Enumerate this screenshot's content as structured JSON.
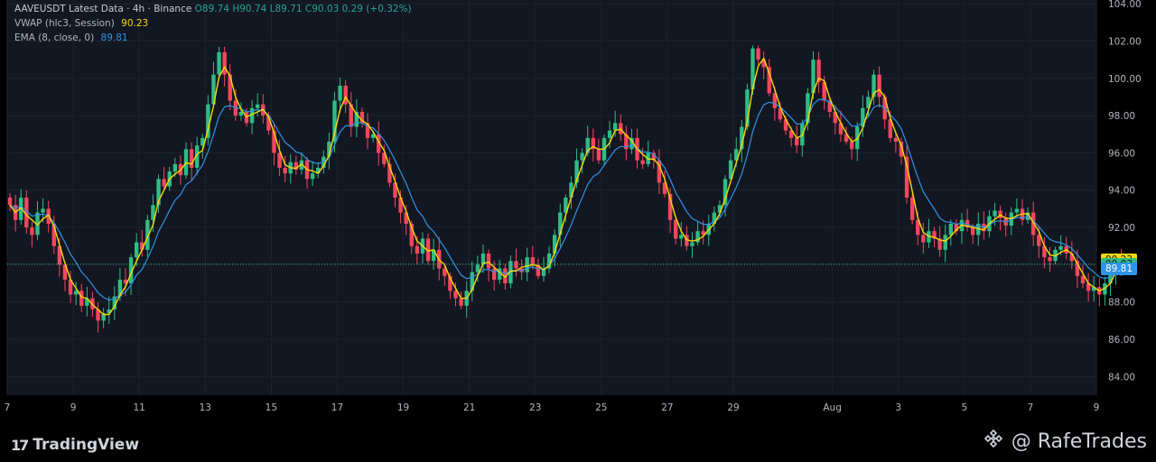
{
  "legend": {
    "symbol": "AAVEUSDT Latest Data · 4h · Binance",
    "ohlc_text": "O89.74 H90.74 L89.71 C90.03 0.29 (+0.32%)",
    "vwap_label": "VWAP (hlc3, Session)",
    "vwap_value": "90.23",
    "ema_label": "EMA (8, close, 0)",
    "ema_value": "89.81"
  },
  "footer": {
    "brand_mark": "17",
    "brand_name": "TradingView",
    "watermark": "@ RafeTrades"
  },
  "badges": {
    "vwap": "90.23",
    "close": "90.03",
    "ema": "89.81"
  },
  "colors": {
    "background": "#000000",
    "up": "#26a69a",
    "down": "#ef5350",
    "up_candle": "#2ebd85",
    "down_candle": "#f6465d",
    "vwap": "#f5d90a",
    "ema": "#2f93e6",
    "grid": "#1e222d",
    "text": "#b2b5be"
  },
  "chart_data": {
    "type": "candlestick",
    "y_ticks": [
      "104.00",
      "102.00",
      "100.00",
      "98.00",
      "96.00",
      "94.00",
      "92.00",
      "90.00",
      "88.00",
      "86.00",
      "84.00"
    ],
    "ylim": [
      83.0,
      104.2
    ],
    "x_ticks": [
      {
        "label": "7",
        "day": 7
      },
      {
        "label": "9",
        "day": 9
      },
      {
        "label": "11",
        "day": 11
      },
      {
        "label": "13",
        "day": 13
      },
      {
        "label": "15",
        "day": 15
      },
      {
        "label": "17",
        "day": 17
      },
      {
        "label": "19",
        "day": 19
      },
      {
        "label": "21",
        "day": 21
      },
      {
        "label": "23",
        "day": 23
      },
      {
        "label": "25",
        "day": 25
      },
      {
        "label": "27",
        "day": 27
      },
      {
        "label": "29",
        "day": 29
      },
      {
        "label": "Aug",
        "day": 32
      },
      {
        "label": "3",
        "day": 34
      },
      {
        "label": "5",
        "day": 36
      },
      {
        "label": "7",
        "day": 38
      },
      {
        "label": "9",
        "day": 40
      }
    ],
    "xlim": [
      7.0,
      40.0
    ],
    "candle_start_day": 7.0,
    "candle_interval_days": 0.1667,
    "close_series": [
      93.2,
      92.4,
      93.6,
      92.0,
      91.6,
      92.8,
      93.0,
      92.2,
      91.0,
      90.0,
      89.2,
      88.4,
      88.6,
      87.8,
      88.2,
      87.6,
      87.0,
      87.4,
      87.6,
      88.3,
      89.2,
      89.0,
      90.4,
      91.2,
      90.8,
      92.4,
      93.2,
      94.6,
      94.2,
      95.0,
      95.4,
      94.8,
      96.2,
      95.2,
      96.4,
      96.8,
      98.6,
      100.2,
      101.4,
      100.2,
      98.8,
      98.0,
      98.2,
      97.6,
      98.4,
      98.6,
      98.0,
      97.2,
      96.0,
      95.2,
      94.9,
      95.5,
      95.1,
      95.6,
      94.6,
      94.9,
      95.2,
      95.8,
      96.6,
      98.8,
      99.6,
      98.6,
      97.4,
      98.2,
      97.6,
      96.8,
      97.0,
      96.0,
      95.4,
      94.4,
      93.6,
      92.8,
      92.2,
      91.0,
      90.6,
      91.4,
      90.2,
      90.8,
      89.8,
      89.4,
      88.6,
      88.2,
      87.8,
      88.6,
      89.6,
      90.0,
      90.6,
      89.8,
      89.2,
      89.8,
      89.0,
      90.2,
      89.8,
      89.6,
      90.4,
      90.0,
      89.4,
      89.8,
      90.6,
      91.6,
      92.8,
      93.6,
      94.4,
      95.6,
      96.0,
      96.8,
      96.2,
      95.6,
      96.8,
      97.2,
      97.6,
      97.0,
      96.2,
      96.8,
      95.6,
      95.4,
      96.0,
      95.6,
      94.4,
      93.8,
      92.4,
      91.4,
      91.6,
      91.0,
      91.2,
      91.8,
      91.6,
      92.2,
      92.8,
      93.2,
      94.6,
      95.6,
      96.2,
      97.4,
      99.4,
      101.6,
      101.0,
      100.6,
      99.2,
      98.4,
      97.8,
      97.2,
      96.8,
      96.4,
      97.6,
      99.2,
      101.0,
      99.8,
      98.8,
      98.2,
      97.6,
      97.0,
      96.6,
      96.2,
      97.4,
      98.4,
      99.0,
      100.2,
      99.0,
      97.8,
      96.8,
      96.6,
      95.8,
      93.6,
      92.4,
      91.6,
      91.2,
      91.8,
      91.4,
      90.8,
      91.6,
      92.2,
      91.8,
      92.4,
      92.0,
      91.6,
      92.2,
      91.8,
      92.6,
      92.9,
      92.5,
      92.1,
      92.8,
      93.0,
      92.4,
      92.8,
      91.6,
      91.0,
      90.4,
      90.2,
      90.8,
      91.0,
      90.6,
      90.2,
      89.4,
      89.0,
      88.6,
      88.8,
      88.4,
      89.0,
      89.6,
      90.2,
      89.8,
      90.0
    ]
  }
}
